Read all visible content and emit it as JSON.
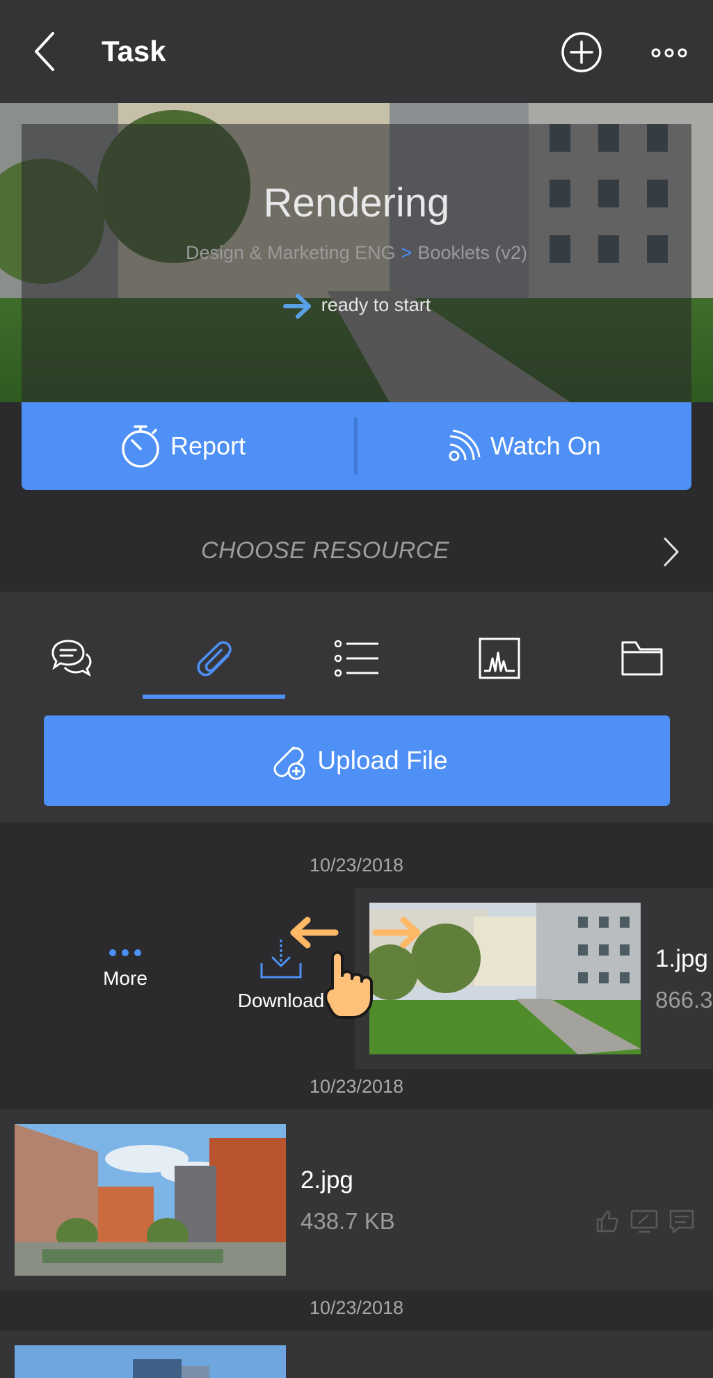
{
  "header": {
    "title": "Task",
    "icons": [
      "back-chevron-icon",
      "add-circle-icon",
      "more-horizontal-icon"
    ]
  },
  "task": {
    "name": "Rendering",
    "breadcrumb": {
      "project": "Design & Marketing ENG",
      "separator": ">",
      "item": "Booklets (v2)"
    },
    "status": "ready to start"
  },
  "actions": {
    "report_label": "Report",
    "watch_label": "Watch On"
  },
  "resource": {
    "label": "CHOOSE RESOURCE"
  },
  "tabs": [
    {
      "name": "comments",
      "icon": "chat-bubbles-icon"
    },
    {
      "name": "attachments",
      "icon": "paperclip-icon",
      "active": true
    },
    {
      "name": "checklist",
      "icon": "list-icon"
    },
    {
      "name": "activity",
      "icon": "chart-icon"
    },
    {
      "name": "folder",
      "icon": "folder-icon"
    }
  ],
  "upload": {
    "label": "Upload File"
  },
  "files": {
    "dates": [
      "10/23/2018",
      "10/23/2018",
      "10/23/2018"
    ],
    "items": [
      {
        "name": "1.jpg",
        "size": "866.3"
      },
      {
        "name": "2.jpg",
        "size": "438.7 KB"
      }
    ],
    "swipe_actions": {
      "more_label": "More",
      "download_label": "Download"
    }
  },
  "colors": {
    "accent": "#4e90f5",
    "background": "#2b2b2d",
    "gesture": "#ffb866"
  }
}
